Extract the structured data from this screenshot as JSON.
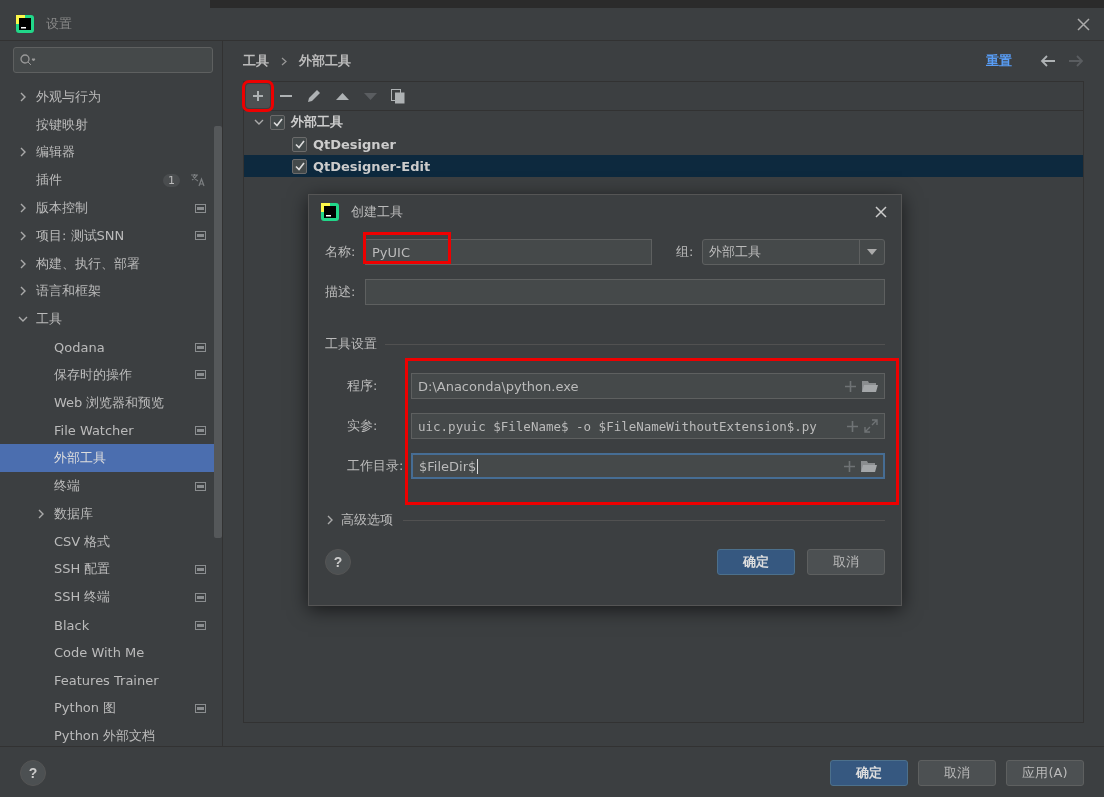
{
  "window": {
    "title": "设置"
  },
  "help_label": "?",
  "sidebar": {
    "items": [
      {
        "label": "外观与行为",
        "kind": "group",
        "expanded": false,
        "selected": false,
        "project": false
      },
      {
        "label": "按键映射",
        "kind": "page",
        "selected": false,
        "project": false
      },
      {
        "label": "编辑器",
        "kind": "group",
        "expanded": false,
        "selected": false,
        "project": false
      },
      {
        "label": "插件",
        "kind": "page",
        "selected": false,
        "project": false,
        "badge": "1",
        "translate": true
      },
      {
        "label": "版本控制",
        "kind": "group",
        "expanded": false,
        "selected": false,
        "project": true
      },
      {
        "label": "项目: 测试SNN",
        "kind": "group",
        "expanded": false,
        "selected": false,
        "project": true
      },
      {
        "label": "构建、执行、部署",
        "kind": "group",
        "expanded": false,
        "selected": false,
        "project": false
      },
      {
        "label": "语言和框架",
        "kind": "group",
        "expanded": false,
        "selected": false,
        "project": false
      },
      {
        "label": "工具",
        "kind": "group",
        "expanded": true,
        "selected": false,
        "project": false,
        "children": [
          {
            "label": "Qodana",
            "kind": "page",
            "selected": false,
            "project": true
          },
          {
            "label": "保存时的操作",
            "kind": "page",
            "selected": false,
            "project": true
          },
          {
            "label": "Web 浏览器和预览",
            "kind": "page",
            "selected": false,
            "project": false
          },
          {
            "label": "File Watcher",
            "kind": "page",
            "selected": false,
            "project": true
          },
          {
            "label": "外部工具",
            "kind": "page",
            "selected": true,
            "project": false
          },
          {
            "label": "终端",
            "kind": "page",
            "selected": false,
            "project": true
          },
          {
            "label": "数据库",
            "kind": "group",
            "expanded": false,
            "selected": false,
            "project": false
          },
          {
            "label": "CSV 格式",
            "kind": "page",
            "selected": false,
            "project": false
          },
          {
            "label": "SSH 配置",
            "kind": "page",
            "selected": false,
            "project": true
          },
          {
            "label": "SSH 终端",
            "kind": "page",
            "selected": false,
            "project": true
          },
          {
            "label": "Black",
            "kind": "page",
            "selected": false,
            "project": true
          },
          {
            "label": "Code With Me",
            "kind": "page",
            "selected": false,
            "project": false
          },
          {
            "label": "Features Trainer",
            "kind": "page",
            "selected": false,
            "project": false
          },
          {
            "label": "Python 图",
            "kind": "page",
            "selected": false,
            "project": true
          },
          {
            "label": "Python 外部文档",
            "kind": "page",
            "selected": false,
            "project": false
          }
        ]
      }
    ]
  },
  "breadcrumb": [
    "工具",
    "外部工具"
  ],
  "reset_link": "重置",
  "nav": [
    {
      "kind": "back",
      "disabled": false
    },
    {
      "kind": "forward",
      "disabled": true
    }
  ],
  "toolbar": [
    {
      "kind": "add",
      "disabled": false,
      "highlighted": true
    },
    {
      "kind": "remove",
      "disabled": false,
      "highlighted": false
    },
    {
      "kind": "edit",
      "disabled": false,
      "highlighted": false
    },
    {
      "kind": "up",
      "disabled": false,
      "highlighted": false
    },
    {
      "kind": "down",
      "disabled": true,
      "highlighted": false
    },
    {
      "kind": "copy",
      "disabled": false,
      "highlighted": false
    }
  ],
  "tree": [
    {
      "label": "外部工具",
      "checked": true,
      "expanded": true,
      "selected": false,
      "children": [
        {
          "label": "QtDesigner",
          "checked": true,
          "selected": false
        },
        {
          "label": "QtDesigner-Edit",
          "checked": true,
          "selected": true
        }
      ]
    }
  ],
  "dialog": {
    "title": "创建工具",
    "name": {
      "label": "名称:",
      "value": "PyUIC",
      "highlighted": true
    },
    "group": {
      "label": "组:",
      "value": "外部工具"
    },
    "description": {
      "label": "描述:"
    },
    "tool_settings": {
      "title": "工具设置",
      "highlighted": true,
      "fields": [
        {
          "label": "程序:",
          "value": "D:\\Anaconda\\python.exe",
          "kind": "browse",
          "focused": false,
          "mono": false
        },
        {
          "label": "实参:",
          "value": "uic.pyuic $FileName$ -o $FileNameWithoutExtension$.py",
          "kind": "expand",
          "focused": false,
          "mono": true
        },
        {
          "label": "工作目录:",
          "value": "$FileDir$",
          "kind": "browse",
          "focused": true,
          "mono": false
        }
      ]
    },
    "advanced": {
      "label": "高级选项",
      "expanded": false
    },
    "help_label": "?",
    "buttons": [
      {
        "label": "确定",
        "primary": true
      },
      {
        "label": "取消",
        "primary": false
      }
    ]
  },
  "footer_buttons": [
    {
      "label": "确定",
      "primary": true
    },
    {
      "label": "取消",
      "primary": false
    },
    {
      "label": "应用(A)",
      "primary": false
    }
  ]
}
